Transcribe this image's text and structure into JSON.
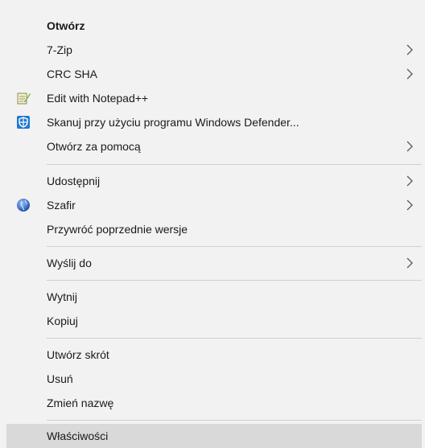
{
  "context_menu": {
    "group1": [
      {
        "label": "Otwórz",
        "bold": true
      },
      {
        "label": "7-Zip",
        "submenu": true
      },
      {
        "label": "CRC SHA",
        "submenu": true
      },
      {
        "label": "Edit with Notepad++",
        "icon": "notepad-plus-plus-icon"
      },
      {
        "label": "Skanuj przy użyciu programu Windows Defender...",
        "icon": "windows-defender-icon"
      },
      {
        "label": "Otwórz za pomocą",
        "submenu": true
      }
    ],
    "group2": [
      {
        "label": "Udostępnij",
        "submenu": true
      },
      {
        "label": "Szafir",
        "icon": "szafir-globe-icon",
        "submenu": true
      },
      {
        "label": "Przywróć poprzednie wersje"
      }
    ],
    "group3": [
      {
        "label": "Wyślij do",
        "submenu": true
      }
    ],
    "group4": [
      {
        "label": "Wytnij"
      },
      {
        "label": "Kopiuj"
      }
    ],
    "group5": [
      {
        "label": "Utwórz skrót"
      },
      {
        "label": "Usuń"
      },
      {
        "label": "Zmień nazwę"
      }
    ],
    "group6": [
      {
        "label": "Właściwości",
        "highlighted": true
      }
    ]
  },
  "colors": {
    "menu_bg": "#f2f2f2",
    "highlight_bg": "#d9d9d9",
    "separator": "#cfcfcf",
    "text": "#1a1a1a"
  }
}
